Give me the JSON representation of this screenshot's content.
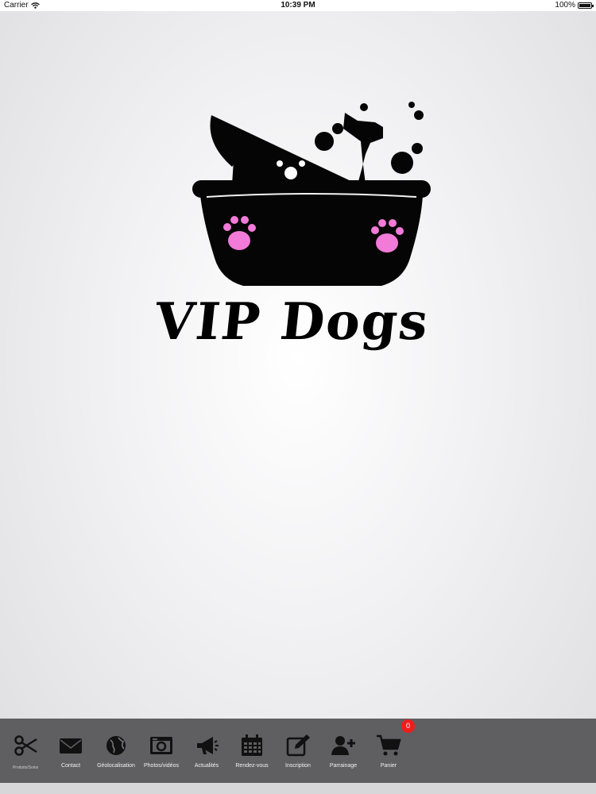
{
  "status_bar": {
    "carrier": "Carrier",
    "time": "10:39 PM",
    "battery": "100%"
  },
  "logo": {
    "text": "VIP Dogs",
    "paw_color": "#f27ad8"
  },
  "tabs": [
    {
      "label": "Produits/Soins",
      "icon": "scissors-icon"
    },
    {
      "label": "Contact",
      "icon": "envelope-icon"
    },
    {
      "label": "Géolocalisation",
      "icon": "globe-icon"
    },
    {
      "label": "Photos/vidéos",
      "icon": "camera-icon"
    },
    {
      "label": "Actualités",
      "icon": "megaphone-icon"
    },
    {
      "label": "Rendez-vous",
      "icon": "calendar-icon"
    },
    {
      "label": "Inscription",
      "icon": "edit-icon"
    },
    {
      "label": "Parrainage",
      "icon": "add-user-icon"
    },
    {
      "label": "Panier",
      "icon": "cart-icon"
    }
  ],
  "cart_badge": "0",
  "colors": {
    "tab_bar": "#5f5e60",
    "badge": "#f01d1d"
  }
}
